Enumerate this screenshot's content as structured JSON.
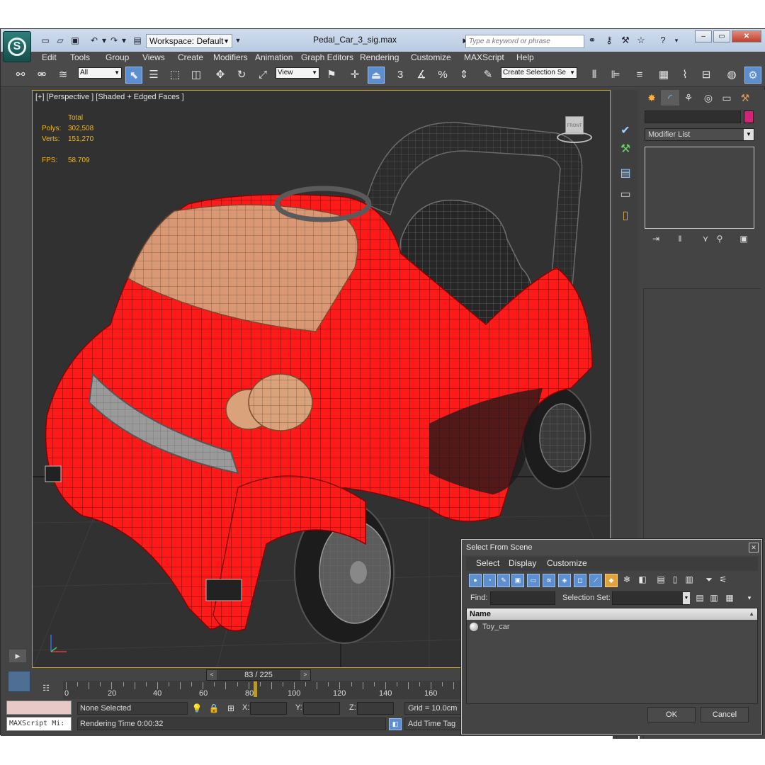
{
  "window": {
    "title": "Pedal_Car_3_sig.max",
    "workspace": "Workspace: Default",
    "search_placeholder": "Type a keyword or phrase"
  },
  "menu": [
    "Edit",
    "Tools",
    "Group",
    "Views",
    "Create",
    "Modifiers",
    "Animation",
    "Graph Editors",
    "Rendering",
    "Customize",
    "MAXScript",
    "Help"
  ],
  "toolbar": {
    "filter_value": "All",
    "coord_system": "View",
    "selection_set_placeholder": "Create Selection Se"
  },
  "viewport": {
    "label": "[+] [Perspective ] [Shaded + Edged Faces ]",
    "stats": {
      "header": "Total",
      "polys_label": "Polys:",
      "polys_value": "302,508",
      "verts_label": "Verts:",
      "verts_value": "151,270",
      "fps_label": "FPS:",
      "fps_value": "58.709"
    },
    "viewcube_label": "FRONT",
    "model_color": "#ff1a1a"
  },
  "command_panel": {
    "modifier_list": "Modifier List",
    "object_color": "#d6237a"
  },
  "timeline": {
    "frame_display": "83 / 225",
    "current_frame": 83,
    "total_frames": 225,
    "ticks": [
      "0",
      "20",
      "40",
      "60",
      "80",
      "100",
      "120",
      "140",
      "160"
    ]
  },
  "status": {
    "maxscript": "MAXScript Mi:",
    "selection": "None Selected",
    "x_label": "X:",
    "y_label": "Y:",
    "z_label": "Z:",
    "grid": "Grid = 10.0cm",
    "render_time": "Rendering Time  0:00:32",
    "add_time_tag": "Add Time Tag"
  },
  "dialog": {
    "title": "Select From Scene",
    "menu": [
      "Select",
      "Display",
      "Customize"
    ],
    "find_label": "Find:",
    "selection_set_label": "Selection Set:",
    "column_name": "Name",
    "rows": [
      "Toy_car"
    ],
    "ok": "OK",
    "cancel": "Cancel"
  }
}
